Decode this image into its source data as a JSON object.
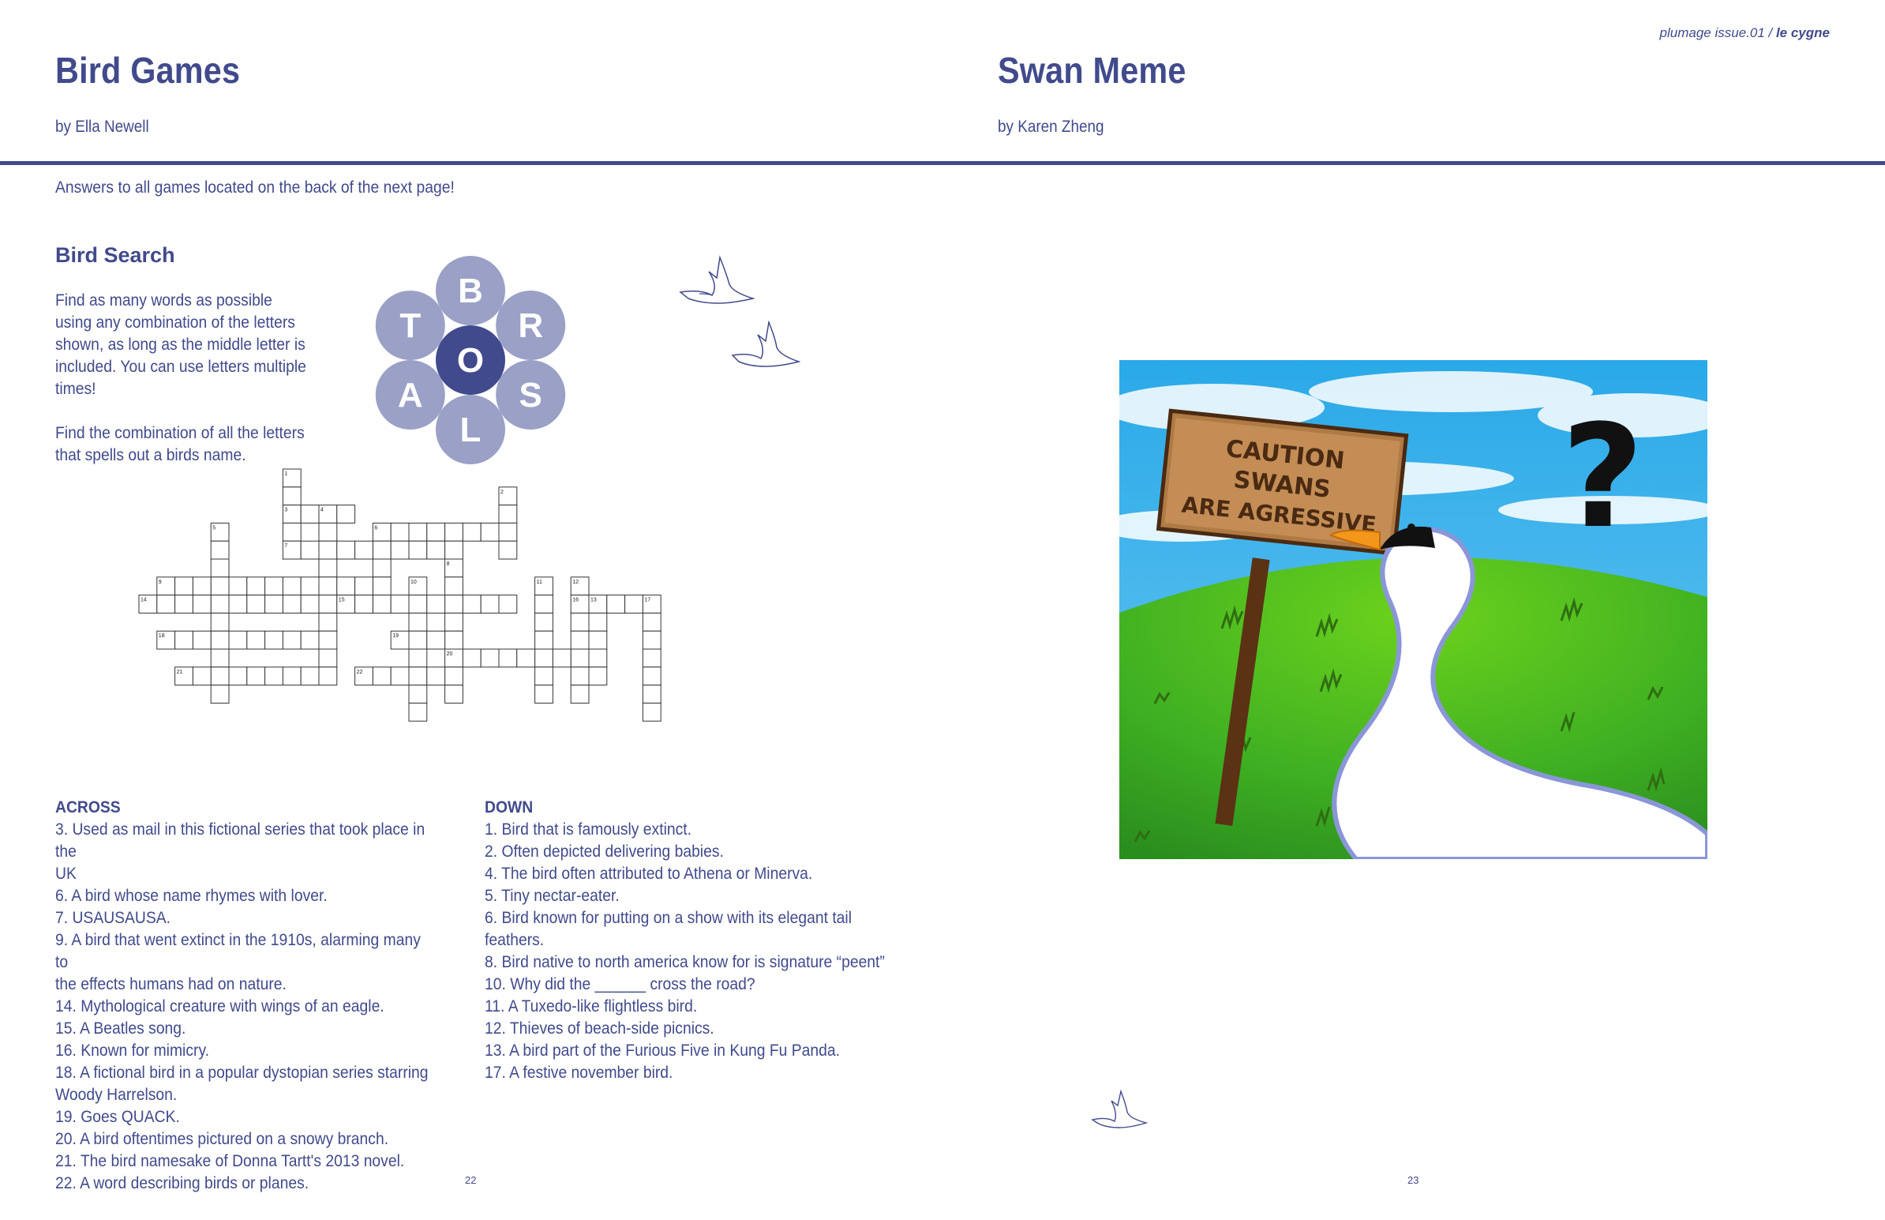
{
  "header": {
    "issue_text": "plumage issue.01 / ",
    "issue_bold": "le cygne"
  },
  "left": {
    "title": "Bird Games",
    "byline": "by Ella Newell",
    "intro": "Answers to all games located on the back of the next page!",
    "search": {
      "heading": "Bird Search",
      "para1": [
        "Find as many words as possible",
        "using any combination of the letters",
        "shown, as long as the middle letter is",
        "included. You can use letters multiple",
        "times!"
      ],
      "para2": [
        "Find the combination of all the letters",
        "that spells out a birds name."
      ],
      "center_letter": "O",
      "outer_letters": [
        "B",
        "R",
        "S",
        "L",
        "A",
        "T"
      ],
      "colors": {
        "outer": "#9aa0c6",
        "center": "#414a8c"
      }
    },
    "crossword": {
      "numbers": [
        "1",
        "2",
        "3",
        "4",
        "5",
        "6",
        "7",
        "8",
        "9",
        "10",
        "11",
        "12",
        "13",
        "14",
        "15",
        "16",
        "17",
        "18",
        "19",
        "20",
        "21",
        "22"
      ]
    },
    "across": {
      "heading": "ACROSS",
      "clues": [
        "3. Used as mail in this fictional series that took place in the",
        "UK",
        "6. A bird whose name rhymes with lover.",
        "7. USAUSAUSA.",
        "9. A bird that went extinct in the 1910s, alarming many to",
        "the effects humans had on nature.",
        "14. Mythological creature with wings of an eagle.",
        "15. A Beatles song.",
        "16. Known for mimicry.",
        "18. A fictional bird in a popular dystopian series starring",
        "Woody Harrelson.",
        "19. Goes QUACK.",
        "20. A bird oftentimes pictured on a snowy branch.",
        "21. The bird namesake of Donna Tartt's 2013 novel.",
        "22. A word describing birds or planes."
      ]
    },
    "down": {
      "heading": "DOWN",
      "clues": [
        "1. Bird that is famously extinct.",
        "2. Often depicted delivering babies.",
        "4. The bird often attributed to Athena or Minerva.",
        "5. Tiny nectar-eater.",
        "6. Bird known for putting on a show with its elegant tail",
        "feathers.",
        "8. Bird native to north america know for is signature “peent”",
        "10. Why did the ______ cross the road?",
        "11. A Tuxedo-like flightless bird.",
        "12. Thieves of beach-side picnics.",
        "13. A bird part of the Furious Five in Kung Fu Panda.",
        "17. A festive november bird."
      ]
    },
    "page_number": "22"
  },
  "right": {
    "title": "Swan Meme",
    "byline": "by Karen Zheng",
    "sign_lines": [
      "CAUTION",
      "SWANS",
      "ARE AGRESSIVE"
    ],
    "question_mark": "?",
    "page_number": "23"
  }
}
